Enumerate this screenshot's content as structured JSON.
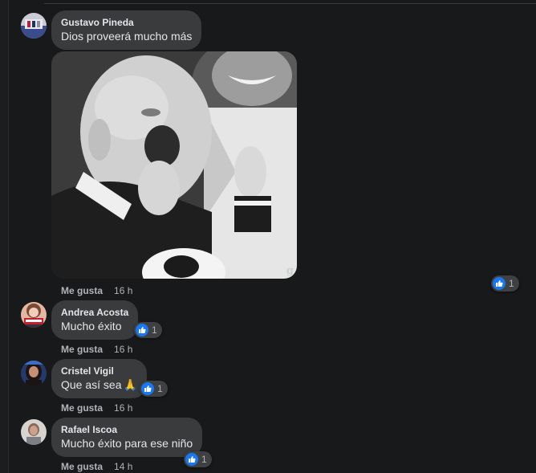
{
  "comments": [
    {
      "author": "Gustavo Pineda",
      "text": "Dios proveerá mucho más",
      "like_label": "Me gusta",
      "time": "16 h",
      "reaction_count": "1",
      "media": {
        "type": "gif",
        "watermark": "g"
      }
    },
    {
      "author": "Andrea Acosta",
      "text": "Mucho éxito",
      "like_label": "Me gusta",
      "time": "16 h",
      "reaction_count": "1"
    },
    {
      "author": "Cristel Vigil",
      "text": "Que así sea",
      "emoji": "🙏",
      "like_label": "Me gusta",
      "time": "16 h",
      "reaction_count": "1"
    },
    {
      "author": "Rafael Iscoa",
      "text": "Mucho éxito para ese niño",
      "like_label": "Me gusta",
      "time": "14 h",
      "reaction_count": "1"
    }
  ],
  "colors": {
    "background": "#18191a",
    "bubble": "#3a3b3c",
    "like_blue": "#1877f2",
    "secondary_text": "#b0b3b8",
    "primary_text": "#e4e6eb"
  },
  "icons": {
    "reaction": "thumbs-up-icon",
    "emoji": "praying-hands-emoji"
  }
}
